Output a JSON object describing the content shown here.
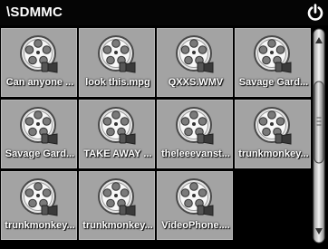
{
  "header": {
    "path": "\\SDMMC"
  },
  "files": [
    {
      "name": "Can anyone ..."
    },
    {
      "name": "look this.mpg"
    },
    {
      "name": "QXXS.WMV"
    },
    {
      "name": "Savage Gard..."
    },
    {
      "name": "Savage Gard..."
    },
    {
      "name": "TAKE AWAY ..."
    },
    {
      "name": "theleeevanst..."
    },
    {
      "name": "trunkmonkey..."
    },
    {
      "name": "trunkmonkey..."
    },
    {
      "name": "trunkmonkey..."
    },
    {
      "name": "VideoPhone...."
    }
  ],
  "icons": {
    "file": "video-file-icon",
    "power": "power-icon"
  },
  "colors": {
    "background": "#000000",
    "tile": "#a3a3a3",
    "label": "#ffffff"
  }
}
